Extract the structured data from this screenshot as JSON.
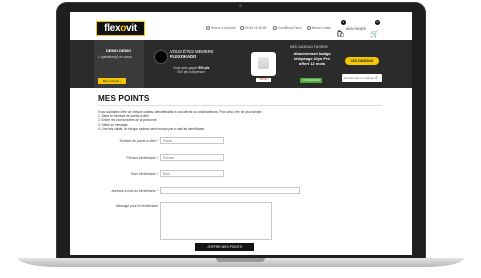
{
  "header": {
    "logo_text_1": "flex",
    "logo_text_2": "o",
    "logo_text_3": "vit",
    "utility_links": [
      "Retour à l'accueil",
      "05 56 18 48 59",
      "Conditions Flexo",
      "Besoin d'aide"
    ],
    "account_label": "MON PANIER",
    "cart_counts": [
      "1",
      "0"
    ]
  },
  "band": {
    "demo_name": "DEMO DEMO",
    "demo_points": "1 opération(s) en cours",
    "account_button": "Mon compte",
    "member_title_1": "VOUS ÊTES MEMBRE",
    "member_title_2": "FLEXOKADO",
    "member_sub_1": "Vous avez gagné",
    "member_sub_points": "500 pts",
    "member_sub_2": "500 pts à dépenser",
    "favorite_title": "MES CADEAUX FAVORIS",
    "favorite_product": "Abonnement badge télépéage Ulys Pro offert 12 mois",
    "favorite_button": "J'COMMANDE",
    "gift_tag": "VIP pts",
    "gifts_button": "LES CADEAUX",
    "search_placeholder": "Rechercher un cadeau"
  },
  "main": {
    "page_title": "MES POINTS",
    "intro_line_1": "Vous souhaitez offrir un chèque cadeau dématérialisé à vos clients ou collaborateurs. Pour cela, rien de plus simple :",
    "intro_line_2": "1. Saisir le montant de points à offrir",
    "intro_line_3": "2. Entrer les coordonnées de la personne",
    "intro_line_4": "3. Saisir un message",
    "intro_line_5": "4. Une fois validé, le chèque cadeau sera envoyé par e-mail au bénéficiaire.",
    "fields": [
      {
        "label": "Nombre de points à offrir *",
        "value": "Points"
      },
      {
        "label": "Prénom bénéficiaire *",
        "value": "Prénom"
      },
      {
        "label": "Nom bénéficiaire *",
        "value": "Nom"
      },
      {
        "label": "Adresse e-mail du bénéficiaire *",
        "value": ""
      },
      {
        "label": "Message pour le bénéficiaire",
        "value": ""
      }
    ],
    "submit_label": "J'OFFRE MES POINTS"
  }
}
